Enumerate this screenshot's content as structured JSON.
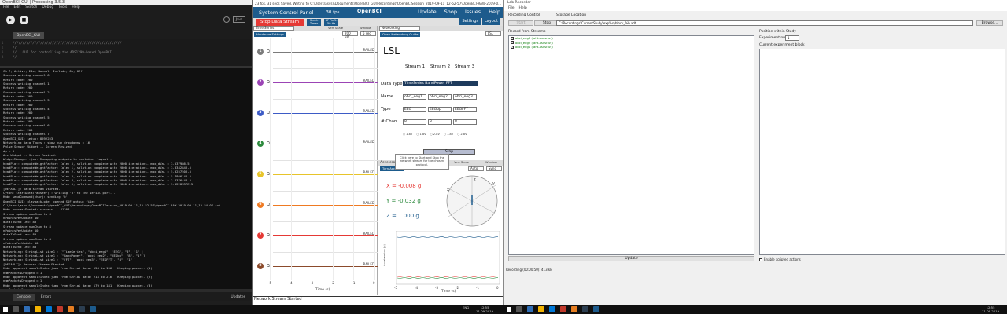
{
  "ide": {
    "window_title": "OpenBCI_GUI | Processing 3.5.3",
    "menu": [
      "File",
      "Edit",
      "Sketch",
      "Debug",
      "Tools",
      "Help"
    ],
    "mode": "Java",
    "tab": "OpenBCI_GUI",
    "code": [
      "///////////////////////////////////////////////////////",
      "//",
      "//   GUI for controlling the ADS1299-based OpenBCI",
      "//"
    ],
    "console": [
      "Ch 7, Active, 24x, Normal, Include, On, Off",
      "Success writing channel 6",
      "Return code: 200",
      "Success writing channel 1",
      "Return code: 200",
      "Success writing channel 2",
      "Return code: 200",
      "Success writing channel 3",
      "Return code: 200",
      "Success writing channel 4",
      "Return code: 200",
      "Success writing channel 5",
      "Return code: 200",
      "Success writing channel 6",
      "Return code: 200",
      "Success writing channel 7",
      "OpenBCI_GUI: setup: 8592253",
      "Networking Data Types : show num dropdowns = 16",
      "Pulse Sensor Widget -- Screen Resized.",
      "dy = 0",
      "Acc Widget -- Screen Resized.",
      "WidgetManager.:job: Remapping widgets to container layout...",
      "headPlot: computeWeightFactor: Iolec 5, solution complete with 2000 iterations. max_dVal = 3.537986-5",
      "headPlot: computeWeightFactor: Iolec 1, solution complete with 2000 iterations. max_dVal = 3.3342846-5",
      "headPlot: computeWeightFactor: Iolec 2, solution complete with 2000 iterations. max_dVal = 5.0257506-5",
      "headPlot: computeWeightFactor: Iolec 3, solution complete with 2000 iterations. max_dVal = 5.7866146-5",
      "headPlot: computeWeightFactor: Iolec 4, solution complete with 2000 iterations. max_dVal = 3.8376448-5",
      "headPlot: computeWeightFactor: Iolec 5, solution complete with 2000 iterations. max_dVal = 3.9228337E-5",
      "[DEFAULT]: Data stream started.",
      "Cyton: startDataTransfer(): writing 'b' to the serial port...",
      "Hub: sendCommand(char): sending 'b'",
      "OpenBCI_GUI: playback.pde: opened SDF output file:",
      "C:\\Users\\asvsr\\Documents\\OpenBCI_GUI\\Recordings\\OpenBCISession_2019-09-11_12-52-57\\OpenBCI-RAW-2019-09-11_12-54-07.txt",
      "Hub: processDenied: success -- 81306",
      "Stream update numChan to 8",
      "nPointsPerUpdate 10",
      "dataToSend len: 80",
      "Stream update numChan to 8",
      "nPointsPerUpdate 10",
      "dataToSend len: 80",
      "Stream update numChan to 8",
      "nPointsPerUpdate 10",
      "dataToSend len: 80",
      "Networking: StringList sizeG : [\"TimeSeries\", \"obci_eeg1\", \"EEG\", \"8\", \"1\" ]",
      "Networking: StringList sizeG : [\"BandPower\", \"obci_eeg2\", \"EEGbp\", \"8\", \"1\" ]",
      "Networking: StringList sizeG : [\"FFT\", \"obci_eeg3\", \"EEGFFT\", \"8\", \"1\" ]",
      "[DEFAULT]: Network Stream Started",
      "Hub: apparent sampleIndex jump from Serial data: 154 to 156.  Keeping packet. (1)",
      "numPacketsDropped = 1",
      "Hub: apparent sampleIndex jump from Serial data: 214 to 216.  Keeping packet. (2)",
      "numPacketsDropped = 1",
      "Hub: apparent sampleIndex jump from Serial data: 179 to 181.  Keeping packet. (3)",
      "numPacketsDropped = 1"
    ],
    "bottom_tabs": [
      "Console",
      "Errors"
    ],
    "updates_label": "Updates"
  },
  "gui": {
    "window_title": "23 fps, 31 secs Saved, Writing to C:\\Users\\asvsr\\Documents\\OpenBCI_GUI\\Recordings\\OpenBCISession_2019-09-11_12-52-57\\OpenBCI-RAW-2019-0...",
    "system_control": "System Control Panel",
    "fps": "30 fps",
    "logo": "OpenBCI",
    "nav": [
      "Update",
      "Shop",
      "Issues",
      "Help"
    ],
    "stop_stream": "Stop Data Stream",
    "small_buttons": [
      "Synch Timer",
      "BF Fix 5-50 Hz"
    ],
    "right_buttons": [
      "Settings",
      "Layout"
    ],
    "ts": {
      "header": "Time Series",
      "vert_scale_label": "Vert Scale",
      "window_label": "Window",
      "vert_scale": "200 uV",
      "window": "5 sec",
      "hardware_settings": "Hardware Settings",
      "railed": "RAILED",
      "channels": [
        {
          "num": "1",
          "color": "#7b7b7b"
        },
        {
          "num": "2",
          "color": "#9b44b5"
        },
        {
          "num": "3",
          "color": "#3d5bc6"
        },
        {
          "num": "4",
          "color": "#2d8a3e"
        },
        {
          "num": "5",
          "color": "#e7c42a"
        },
        {
          "num": "6",
          "color": "#ef7a22"
        },
        {
          "num": "7",
          "color": "#e53935"
        },
        {
          "num": "8",
          "color": "#8b4a2b"
        }
      ],
      "xticks": [
        "-5",
        "-4",
        "-3",
        "-2",
        "-1",
        "0"
      ],
      "xlabel": "Time (s)"
    },
    "net": {
      "header": "Networking",
      "protocol": "LSL",
      "open_guide": "Open Networking Guide",
      "title": "LSL",
      "stream_headers": [
        "Stream 1",
        "Stream 2",
        "Stream 3"
      ],
      "data_type_label": "Data Type",
      "data_types": "TimeSeries  BandPower  FFT",
      "name_label": "Name",
      "names": [
        "obci_eeg1",
        "obci_eeg2",
        "obci_eeg3"
      ],
      "type_label": "Type",
      "types": [
        "EEG",
        "EEGbp",
        "EEGFFT"
      ],
      "chan_label": "# Chan",
      "chans": [
        "8",
        "8",
        "8"
      ],
      "radio": [
        "1-8V",
        "1-8V",
        "2-8V",
        "1-8V",
        "2-8V"
      ],
      "stop": "Stop",
      "tooltip": "Click here to Start and Stop the network stream for the chosen protocol."
    },
    "acc": {
      "header": "Accelerometer",
      "vert_scale_label": "Vert Scale",
      "window_label": "Window",
      "vert_scale": "Auto",
      "window": "Sync",
      "turn_btn": "Turn Acc. Off",
      "x": "X = -0.008 g",
      "y": "Y = -0.032 g",
      "z": "Z = 1.000 g",
      "xticks": [
        "-5",
        "-4",
        "-3",
        "-2",
        "-1",
        "0"
      ],
      "xlabel": "Time (s)",
      "ylabel": "Acceleration (g)"
    },
    "status": "Network Stream Started"
  },
  "lab": {
    "window_title": "Lab Recorder",
    "menu": [
      "File",
      "Help"
    ],
    "recording_control": "Recording Control",
    "start": "Start",
    "stop": "Stop",
    "storage_label": "Storage Location",
    "storage_path": "C:\\Recordings\\CurrentStudy\\exp%n\\block_%b.xdf",
    "browse": "Browse...",
    "record_from": "Record from Streams",
    "streams": [
      "obci_eeg3 (iaht-asvsr-us)",
      "obci_eeg2 (iaht-asvsr-us)",
      "obci_eeg1 (iaht-asvsr-us)"
    ],
    "position_label": "Position within Study",
    "exp_num_label": "Experiment number",
    "exp_num": "1",
    "block_label": "Current experiment block",
    "update": "Update",
    "enable_remote": "Enable scripted actions",
    "recording_status": "Recording (00:00:50): 413 kb"
  },
  "taskbar": {
    "lang": "ENG",
    "left_time": "12:55",
    "left_date": "11-09-2019",
    "right_time": "12:55",
    "right_date": "11-09-2019"
  }
}
